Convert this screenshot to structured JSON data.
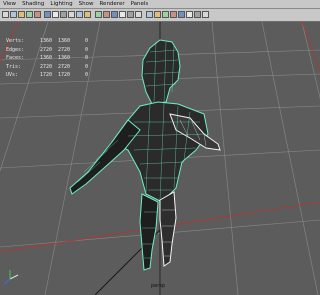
{
  "menu": [
    "View",
    "Shading",
    "Lighting",
    "Show",
    "Renderer",
    "Panels"
  ],
  "toolbar": {
    "icons": [
      "select-camera-icon",
      "lock-camera-icon",
      "camera-attributes-icon",
      "bookmark-icon",
      "image-plane-icon",
      "grid-icon",
      "film-gate-icon",
      "resolution-gate-icon",
      "safe-action-icon",
      "safe-title-icon",
      "field-chart-icon",
      "wireframe-icon",
      "smooth-shade-icon",
      "textured-icon",
      "lighting-icon",
      "shadows-icon",
      "xray-icon",
      "isolate-icon",
      "xray-joints-icon",
      "xray-components-icon",
      "hud-icon",
      "backface-icon",
      "resolution-icon",
      "playblast-icon",
      "gear-icon"
    ]
  },
  "hud": {
    "rows": [
      {
        "label": "Verts:",
        "a": "1360",
        "b": "1360",
        "c": "0"
      },
      {
        "label": "Edges:",
        "a": "2720",
        "b": "2720",
        "c": "0"
      },
      {
        "label": "Faces:",
        "a": "1360",
        "b": "1360",
        "c": "0"
      },
      {
        "label": "Tris:",
        "a": "2720",
        "b": "2720",
        "c": "0"
      },
      {
        "label": "UVs:",
        "a": "1720",
        "b": "1720",
        "c": "0"
      }
    ]
  },
  "camera_label": "persp",
  "colors": {
    "background": "#5c5c5c",
    "grid": "#8a8a8a",
    "axis": "#1a1a1a",
    "axis_x": "#c0302a",
    "mesh_selected": "#6ef0c4",
    "mesh_body": "#2b2b2b",
    "mesh_white": "#f4f4f4"
  }
}
